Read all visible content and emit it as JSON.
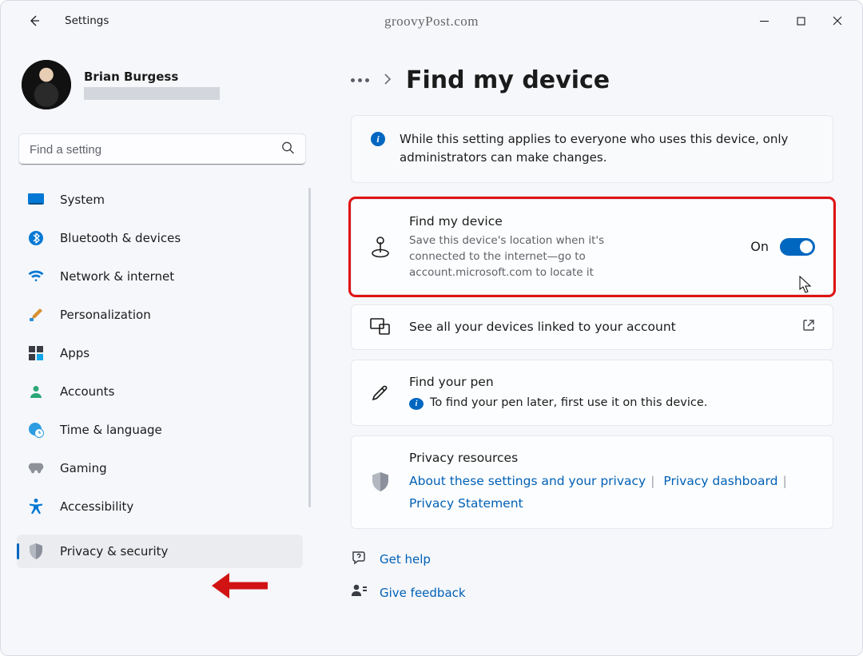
{
  "watermark": "groovyPost.com",
  "app_title": "Settings",
  "account": {
    "name": "Brian Burgess"
  },
  "search": {
    "placeholder": "Find a setting"
  },
  "nav": {
    "items": [
      {
        "label": "System"
      },
      {
        "label": "Bluetooth & devices"
      },
      {
        "label": "Network & internet"
      },
      {
        "label": "Personalization"
      },
      {
        "label": "Apps"
      },
      {
        "label": "Accounts"
      },
      {
        "label": "Time & language"
      },
      {
        "label": "Gaming"
      },
      {
        "label": "Accessibility"
      },
      {
        "label": "Privacy & security"
      }
    ]
  },
  "page": {
    "title": "Find my device",
    "banner": "While this setting applies to everyone who uses this device, only administrators can make changes.",
    "find_card": {
      "title": "Find my device",
      "desc": "Save this device's location when it's connected to the internet—go to account.microsoft.com to locate it",
      "state": "On"
    },
    "devices_card": {
      "title": "See all your devices linked to your account"
    },
    "pen_card": {
      "title": "Find your pen",
      "desc": "To find your pen later, first use it on this device."
    },
    "privacy_card": {
      "title": "Privacy resources",
      "links": {
        "about": "About these settings and your privacy",
        "dashboard": "Privacy dashboard",
        "statement": "Privacy Statement"
      }
    },
    "help": "Get help",
    "feedback": "Give feedback"
  }
}
